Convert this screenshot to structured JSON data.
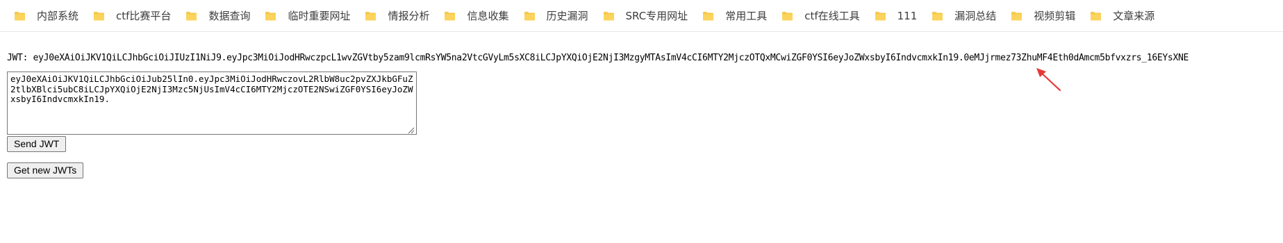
{
  "bookmarks": [
    {
      "label": "内部系统",
      "icon": "folder-icon"
    },
    {
      "label": "ctf比赛平台",
      "icon": "folder-icon"
    },
    {
      "label": "数据查询",
      "icon": "folder-icon"
    },
    {
      "label": "临时重要网址",
      "icon": "folder-icon"
    },
    {
      "label": "情报分析",
      "icon": "folder-icon"
    },
    {
      "label": "信息收集",
      "icon": "folder-icon"
    },
    {
      "label": "历史漏洞",
      "icon": "folder-icon"
    },
    {
      "label": "SRC专用网址",
      "icon": "folder-icon"
    },
    {
      "label": "常用工具",
      "icon": "folder-icon"
    },
    {
      "label": "ctf在线工具",
      "icon": "folder-icon"
    },
    {
      "label": "111",
      "icon": "folder-icon"
    },
    {
      "label": "漏洞总结",
      "icon": "folder-icon"
    },
    {
      "label": "视频剪辑",
      "icon": "folder-icon"
    },
    {
      "label": "文章来源",
      "icon": "folder-icon"
    }
  ],
  "jwt": {
    "line": "JWT: eyJ0eXAiOiJKV1QiLCJhbGciOiJIUzI1NiJ9.eyJpc3MiOiJodHRwczpcL1wvZGVtby5zam9lcmRsYW5na2VtcGVyLm5sXC8iLCJpYXQiOjE2NjI3MzgyMTAsImV4cCI6MTY2MjczOTQxMCwiZGF0YSI6eyJoZWxsbyI6IndvcmxkIn19.0eMJjrmez73ZhuMF4Eth0dAmcm5bfvxzrs_16EYsXNE",
    "textarea_value": "eyJ0eXAiOiJKV1QiLCJhbGciOiJub25lIn0.eyJpc3MiOiJodHRwczovL2RlbW8uc2pvZXJkbGFuZ2tlbXBlci5ubC8iLCJpYXQiOjE2NjI3Mzc5NjUsImV4cCI6MTY2MjczOTE2NSwiZGF0YSI6eyJoZWxsbyI6IndvcmxkIn19."
  },
  "buttons": {
    "send_label": "Send JWT",
    "get_label": "Get new JWTs"
  },
  "colors": {
    "folder": "#f7c948",
    "annotation_arrow": "#e53935"
  }
}
